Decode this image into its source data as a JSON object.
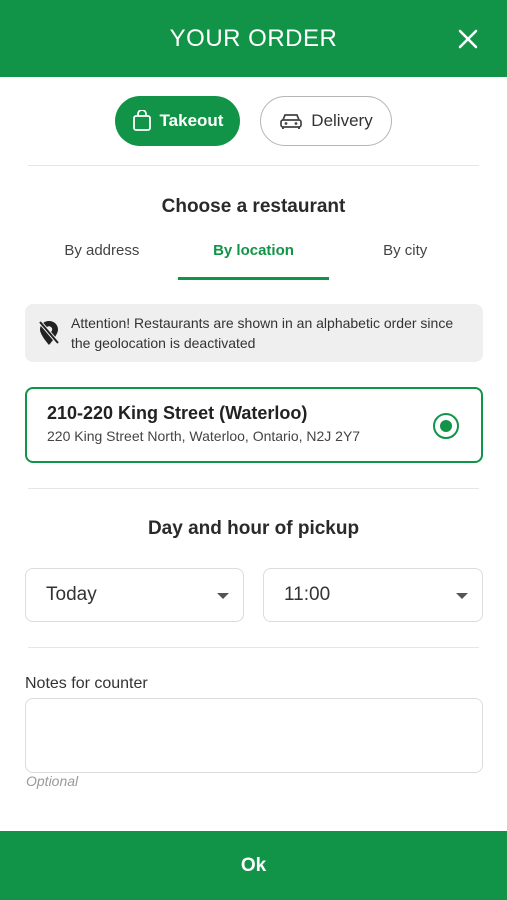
{
  "header": {
    "title": "YOUR ORDER",
    "close_icon": "close-icon"
  },
  "mode": {
    "takeout_label": "Takeout",
    "delivery_label": "Delivery",
    "selected": "Takeout"
  },
  "restaurant_section": {
    "title": "Choose a restaurant",
    "tabs": [
      {
        "label": "By address",
        "active": false
      },
      {
        "label": "By location",
        "active": true
      },
      {
        "label": "By city",
        "active": false
      }
    ],
    "attention_text": "Attention! Restaurants are shown in an alphabetic order since the geolocation is deactivated",
    "restaurant": {
      "name": "210-220 King Street (Waterloo)",
      "address": "220 King Street North, Waterloo, Ontario, N2J 2Y7",
      "selected": true
    }
  },
  "pickup_section": {
    "title": "Day and hour of pickup",
    "day_value": "Today",
    "hour_value": "11:00"
  },
  "notes": {
    "label": "Notes for counter",
    "value": "",
    "helper": "Optional"
  },
  "footer": {
    "ok_label": "Ok"
  },
  "colors": {
    "brand": "#119447"
  }
}
